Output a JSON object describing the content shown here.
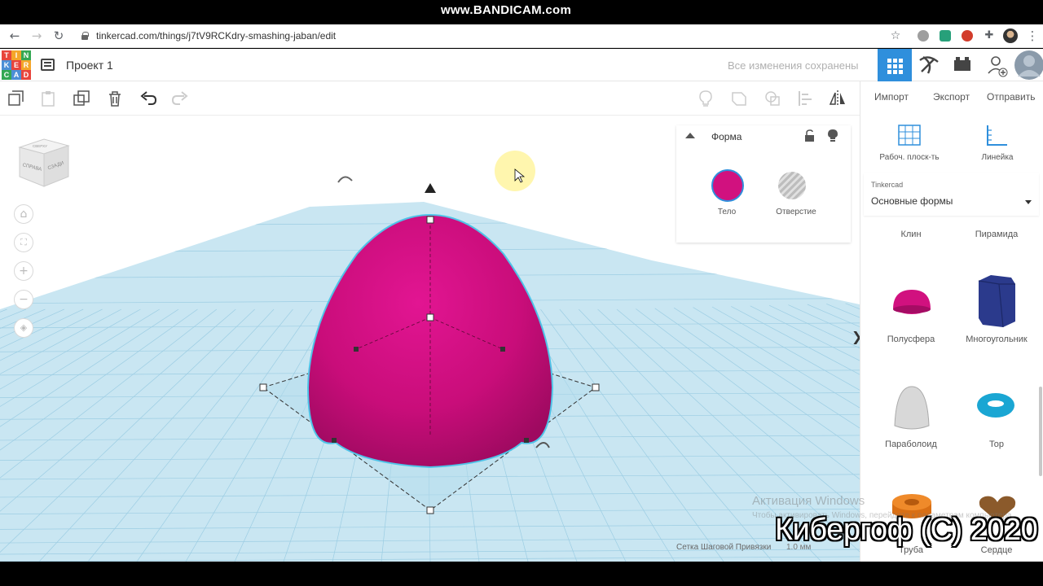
{
  "browser": {
    "url": "tinkercad.com/things/j7tV9RCKdry-smashing-jaban/edit",
    "watermark": "www.BANDICAM.com"
  },
  "app": {
    "logo_letters": [
      "T",
      "I",
      "N",
      "K",
      "E",
      "R",
      "C",
      "A",
      "D"
    ],
    "project_title": "Проект 1",
    "save_status": "Все изменения сохранены"
  },
  "right_toolbar": {
    "import": "Импорт",
    "export": "Экспорт",
    "send": "Отправить"
  },
  "view_cube": {
    "front": "СПРАВА",
    "right": "СЗАДИ",
    "top": "СВЕРХУ"
  },
  "shape_panel": {
    "title": "Форма",
    "solid_label": "Тело",
    "hole_label": "Отверстие",
    "solid_color": "#d1117f"
  },
  "right_panel": {
    "workplane": "Рабоч. плоск-ть",
    "ruler": "Линейка",
    "library_source": "Tinkercad",
    "library_name": "Основные формы",
    "shapes": [
      {
        "name": "Клин"
      },
      {
        "name": "Пирамида"
      },
      {
        "name": "Полусфера"
      },
      {
        "name": "Многоугольник"
      },
      {
        "name": "Параболоид"
      },
      {
        "name": "Тор"
      },
      {
        "name": "Труба"
      },
      {
        "name": "Сердце"
      }
    ]
  },
  "footer": {
    "windows_activation": "Активация Windows",
    "windows_activation_sub": "Чтобы активировать Windows, перейдите к параметрам компьютера.",
    "grid_snap_label": "Сетка Шаговой Привязки",
    "grid_snap_value": "1.0 мм",
    "copyright": "Кибергоф (С) 2020"
  }
}
